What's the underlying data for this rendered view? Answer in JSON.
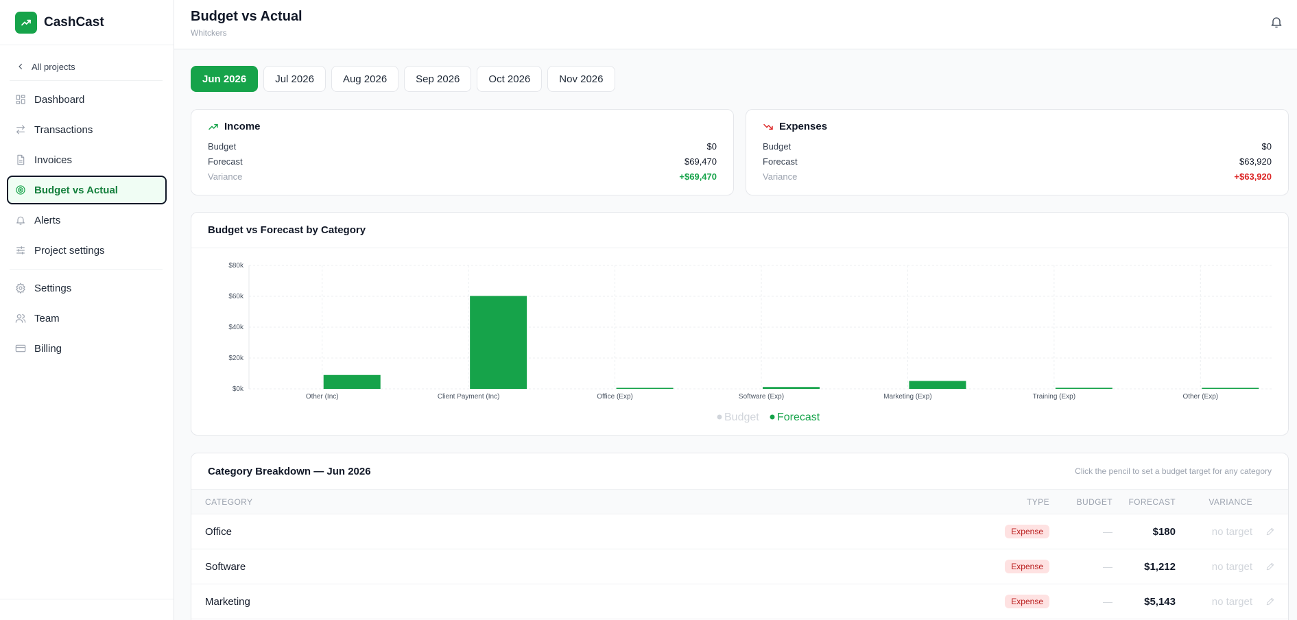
{
  "app": {
    "name": "CashCast"
  },
  "sidebar": {
    "back_label": "All projects",
    "items": [
      {
        "label": "Dashboard",
        "icon": "grid-icon"
      },
      {
        "label": "Transactions",
        "icon": "arrows-icon"
      },
      {
        "label": "Invoices",
        "icon": "document-icon"
      },
      {
        "label": "Budget vs Actual",
        "icon": "target-icon",
        "active": true
      },
      {
        "label": "Alerts",
        "icon": "bell-icon"
      },
      {
        "label": "Project settings",
        "icon": "sliders-icon"
      }
    ],
    "secondary_items": [
      {
        "label": "Settings",
        "icon": "gear-icon"
      },
      {
        "label": "Team",
        "icon": "users-icon"
      },
      {
        "label": "Billing",
        "icon": "card-icon"
      }
    ]
  },
  "header": {
    "title": "Budget vs Actual",
    "subtitle": "Whitckers"
  },
  "months": [
    "Jun 2026",
    "Jul 2026",
    "Aug 2026",
    "Sep 2026",
    "Oct 2026",
    "Nov 2026"
  ],
  "active_month": "Jun 2026",
  "income": {
    "title": "Income",
    "budget_label": "Budget",
    "budget": "$0",
    "forecast_label": "Forecast",
    "forecast": "$69,470",
    "variance_label": "Variance",
    "variance": "+$69,470"
  },
  "expenses": {
    "title": "Expenses",
    "budget_label": "Budget",
    "budget": "$0",
    "forecast_label": "Forecast",
    "forecast": "$63,920",
    "variance_label": "Variance",
    "variance": "+$63,920"
  },
  "chart_title": "Budget vs Forecast by Category",
  "chart_data": {
    "type": "bar",
    "categories": [
      "Other (Inc)",
      "Client Payment (Inc)",
      "Office (Exp)",
      "Software (Exp)",
      "Marketing (Exp)",
      "Training (Exp)",
      "Other (Exp)"
    ],
    "series": [
      {
        "name": "Budget",
        "values": [
          0,
          0,
          0,
          0,
          0,
          0,
          0
        ],
        "color": "#d1d5db"
      },
      {
        "name": "Forecast",
        "values": [
          9000,
          60200,
          180,
          1212,
          5143,
          700,
          600
        ],
        "color": "#16a34a"
      }
    ],
    "ylim": [
      0,
      80000
    ],
    "yticks": [
      0,
      20000,
      40000,
      60000,
      80000
    ],
    "ytick_labels": [
      "$0k",
      "$20k",
      "$40k",
      "$60k",
      "$80k"
    ],
    "legend": "bottom-center",
    "grid": true
  },
  "table": {
    "title": "Category Breakdown — Jun 2026",
    "hint": "Click the pencil to set a budget target for any category",
    "columns": {
      "category": "CATEGORY",
      "type": "TYPE",
      "budget": "BUDGET",
      "forecast": "FORECAST",
      "variance": "VARIANCE"
    },
    "rows": [
      {
        "category": "Office",
        "type": "Expense",
        "budget": "—",
        "forecast": "$180",
        "variance": "no target"
      },
      {
        "category": "Software",
        "type": "Expense",
        "budget": "—",
        "forecast": "$1,212",
        "variance": "no target"
      },
      {
        "category": "Marketing",
        "type": "Expense",
        "budget": "—",
        "forecast": "$5,143",
        "variance": "no target"
      }
    ]
  },
  "colors": {
    "accent": "#16a34a",
    "negative": "#dc2626"
  }
}
